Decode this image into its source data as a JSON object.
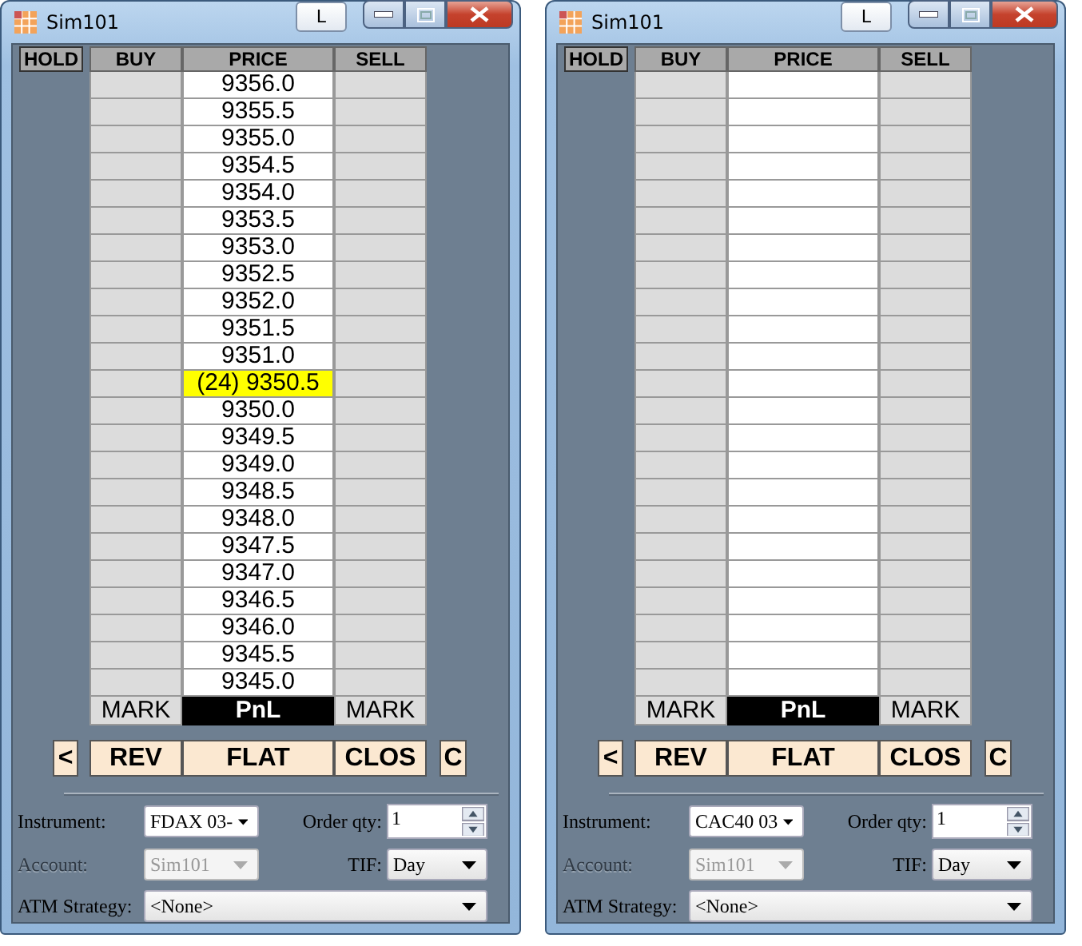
{
  "windows": [
    {
      "title": "Sim101",
      "link_button": "L",
      "columns": [
        "HOLD",
        "BUY",
        "PRICE",
        "SELL"
      ],
      "rows": [
        {
          "price": "9356.0",
          "highlighted": false
        },
        {
          "price": "9355.5",
          "highlighted": false
        },
        {
          "price": "9355.0",
          "highlighted": false
        },
        {
          "price": "9354.5",
          "highlighted": false
        },
        {
          "price": "9354.0",
          "highlighted": false
        },
        {
          "price": "9353.5",
          "highlighted": false
        },
        {
          "price": "9353.0",
          "highlighted": false
        },
        {
          "price": "9352.5",
          "highlighted": false
        },
        {
          "price": "9352.0",
          "highlighted": false
        },
        {
          "price": "9351.5",
          "highlighted": false
        },
        {
          "price": "9351.0",
          "highlighted": false
        },
        {
          "price": "(24) 9350.5",
          "highlighted": true
        },
        {
          "price": "9350.0",
          "highlighted": false
        },
        {
          "price": "9349.5",
          "highlighted": false
        },
        {
          "price": "9349.0",
          "highlighted": false
        },
        {
          "price": "9348.5",
          "highlighted": false
        },
        {
          "price": "9348.0",
          "highlighted": false
        },
        {
          "price": "9347.5",
          "highlighted": false
        },
        {
          "price": "9347.0",
          "highlighted": false
        },
        {
          "price": "9346.5",
          "highlighted": false
        },
        {
          "price": "9346.0",
          "highlighted": false
        },
        {
          "price": "9345.5",
          "highlighted": false
        },
        {
          "price": "9345.0",
          "highlighted": false
        }
      ],
      "footer": [
        "MARK",
        "PnL",
        "MARK"
      ],
      "buttons": [
        "<",
        "REV",
        "FLAT",
        "CLOS",
        "C"
      ],
      "instrument": {
        "label": "Instrument:",
        "value": "FDAX 03-"
      },
      "order_qty": {
        "label": "Order qty:",
        "value": "1"
      },
      "account": {
        "label": "Account:",
        "value": "Sim101",
        "disabled": true
      },
      "tif": {
        "label": "TIF:",
        "value": "Day"
      },
      "atm_strategy": {
        "label": "ATM Strategy:",
        "value": "<None>"
      }
    },
    {
      "title": "Sim101",
      "link_button": "L",
      "columns": [
        "HOLD",
        "BUY",
        "PRICE",
        "SELL"
      ],
      "rows": [
        {
          "highlighted": false
        },
        {
          "highlighted": false
        },
        {
          "highlighted": false
        },
        {
          "highlighted": false
        },
        {
          "highlighted": false
        },
        {
          "highlighted": false
        },
        {
          "highlighted": false
        },
        {
          "highlighted": false
        },
        {
          "highlighted": false
        },
        {
          "highlighted": false
        },
        {
          "highlighted": false
        },
        {
          "highlighted": false
        },
        {
          "highlighted": false
        },
        {
          "highlighted": false
        },
        {
          "highlighted": false
        },
        {
          "highlighted": false
        },
        {
          "highlighted": false
        },
        {
          "highlighted": false
        },
        {
          "highlighted": false
        },
        {
          "highlighted": false
        },
        {
          "highlighted": false
        },
        {
          "highlighted": false
        },
        {
          "highlighted": false
        }
      ],
      "footer": [
        "MARK",
        "PnL",
        "MARK"
      ],
      "buttons": [
        "<",
        "REV",
        "FLAT",
        "CLOS",
        "C"
      ],
      "instrument": {
        "label": "Instrument:",
        "value": "CAC40 03"
      },
      "order_qty": {
        "label": "Order qty:",
        "value": "1"
      },
      "account": {
        "label": "Account:",
        "value": "Sim101",
        "disabled": true
      },
      "tif": {
        "label": "TIF:",
        "value": "Day"
      },
      "atm_strategy": {
        "label": "ATM Strategy:",
        "value": "<None>"
      }
    }
  ]
}
